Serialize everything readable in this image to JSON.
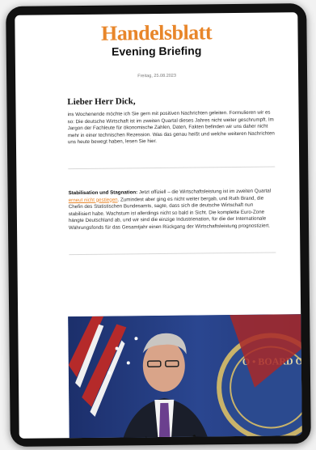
{
  "masthead": {
    "brand": "Handelsblatt",
    "edition": "Evening Briefing"
  },
  "date": "Freitag, 25.08.2023",
  "greeting": "Lieber Herr Dick,",
  "intro": "ins Wochenende möchte ich Sie gern mit positiven Nachrichten geleiten. Formulieren wir es so: Die deutsche Wirtschaft ist im zweiten Quartal dieses Jahres nicht weiter geschrumpft. Im Jargon der Fachleute für ökonomische Zahlen, Daten, Fakten befinden wir uns daher nicht mehr in einer technischen Rezession. Was das genau heißt und welche weiteren Nachrichten uns heute bewegt haben, lesen Sie hier.",
  "article": {
    "lead": "Stabilisation und Stagnation:",
    "text_before": " Jetzt offiziell – die Wirtschaftsleistung ist im zweiten Quartal ",
    "link": "erneut nicht gestiegen",
    "text_after": ". Zumindest aber ging es nicht weiter bergab, und Ruth Brand, die Chefin des Statistischen Bundesamts, sagte, dass sich die deutsche Wirtschaft nun stabilisiert habe. Wachstum ist allerdings nicht so bald in Sicht. Die komplette Euro-Zone hängte Deutschland ab, und wir sind die einzige Industrienation, für die der Internationale Währungsfonds für das Gesamtjahr einen Rückgang der Wirtschaftsleistung prognostiziert."
  },
  "colors": {
    "brand": "#e8862a",
    "link": "#e8862a"
  }
}
